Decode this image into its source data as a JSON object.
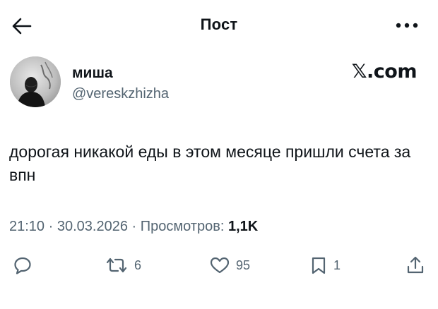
{
  "header": {
    "title": "Пост",
    "back_icon": "arrow-left-icon",
    "more_icon": "more-horizontal-icon"
  },
  "author": {
    "name": "миша",
    "handle": "@vereskzhizha",
    "source": "𝕏.com"
  },
  "tweet": {
    "text": "дорогая никакой еды в этом месяце пришли счета за впн"
  },
  "meta": {
    "time": "21:10",
    "separator": " · ",
    "date": "30.03.2026",
    "views_label": "Просмотров:",
    "views_count": "1,1K"
  },
  "actions": {
    "reply": {
      "icon": "reply-icon",
      "count": ""
    },
    "repost": {
      "icon": "repost-icon",
      "count": "6"
    },
    "like": {
      "icon": "heart-icon",
      "count": "95"
    },
    "bookmark": {
      "icon": "bookmark-icon",
      "count": "1"
    },
    "share": {
      "icon": "share-icon",
      "count": ""
    }
  },
  "colors": {
    "text": "#0f1419",
    "secondary": "#536471",
    "background": "#ffffff"
  }
}
